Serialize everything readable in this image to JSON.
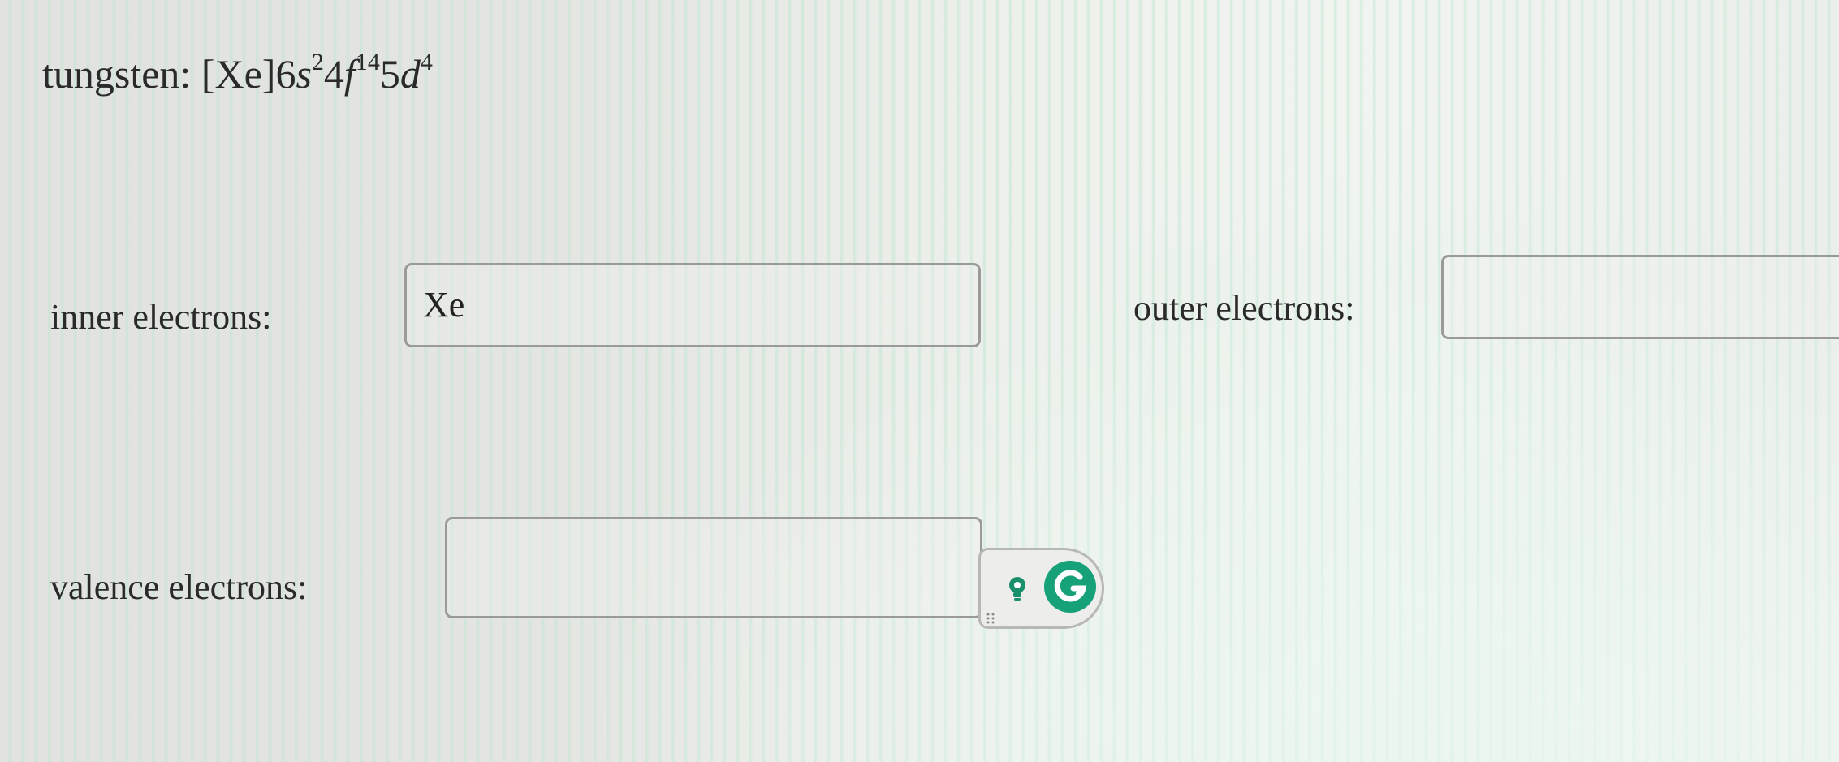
{
  "formula": {
    "prefix": "tungsten: [Xe]",
    "s_coef": "6",
    "s_orbital": "s",
    "s_exp": "2",
    "f_coef": "4",
    "f_orbital": "f",
    "f_exp": "14",
    "d_coef": "5",
    "d_orbital": "d",
    "d_exp": "4"
  },
  "inner": {
    "label": "inner electrons:",
    "value": "Xe"
  },
  "outer": {
    "label": "outer electrons:",
    "value": ""
  },
  "valence": {
    "label": "valence electrons:",
    "value": ""
  },
  "icons": {
    "lightbulb": "lightbulb-icon",
    "grammarly": "grammarly-logo-icon",
    "drag": "drag-handle-icon"
  },
  "colors": {
    "grammarly_green": "#16a179",
    "border": "#9a9a98",
    "text": "#2a2a2a"
  }
}
